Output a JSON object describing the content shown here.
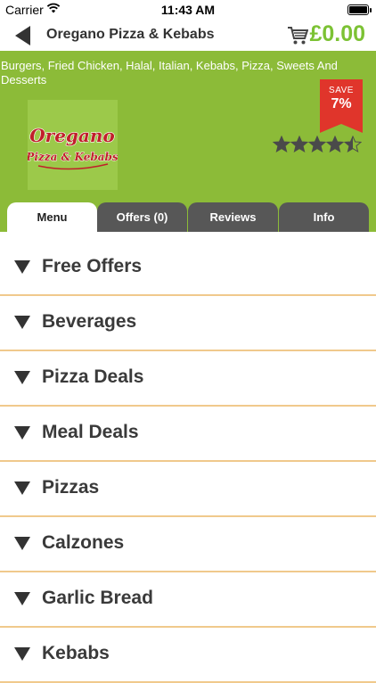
{
  "status_bar": {
    "carrier": "Carrier",
    "time": "11:43 AM"
  },
  "header": {
    "title": "Oregano Pizza & Kebabs",
    "cart_total": "£0.00"
  },
  "restaurant": {
    "cuisines": "Burgers, Fried Chicken, Halal, Italian, Kebabs, Pizza, Sweets And Desserts",
    "save_badge": {
      "label": "SAVE",
      "percent": "7%"
    },
    "logo_text": {
      "line1": "Oregano",
      "line2": "Pizza & Kebabs"
    },
    "rating": 4.5,
    "rating_max": 5
  },
  "tabs": [
    {
      "label": "Menu",
      "active": true
    },
    {
      "label": "Offers (0)",
      "active": false
    },
    {
      "label": "Reviews",
      "active": false
    },
    {
      "label": "Info",
      "active": false
    }
  ],
  "menu_categories": [
    "Free Offers",
    "Beverages",
    "Pizza Deals",
    "Meal Deals",
    "Pizzas",
    "Calzones",
    "Garlic Bread",
    "Kebabs"
  ],
  "colors": {
    "brand_green": "#8cbb38",
    "price_green": "#7cc234",
    "badge_red": "#e0352b",
    "tab_dark": "#575757",
    "divider": "#f0c98c",
    "logo_red": "#c0202a"
  },
  "icons": {
    "back": "back-arrow-icon",
    "cart": "shopping-cart-icon",
    "wifi": "wifi-icon",
    "battery": "battery-icon",
    "expand": "triangle-down-icon",
    "star": "star-icon"
  }
}
